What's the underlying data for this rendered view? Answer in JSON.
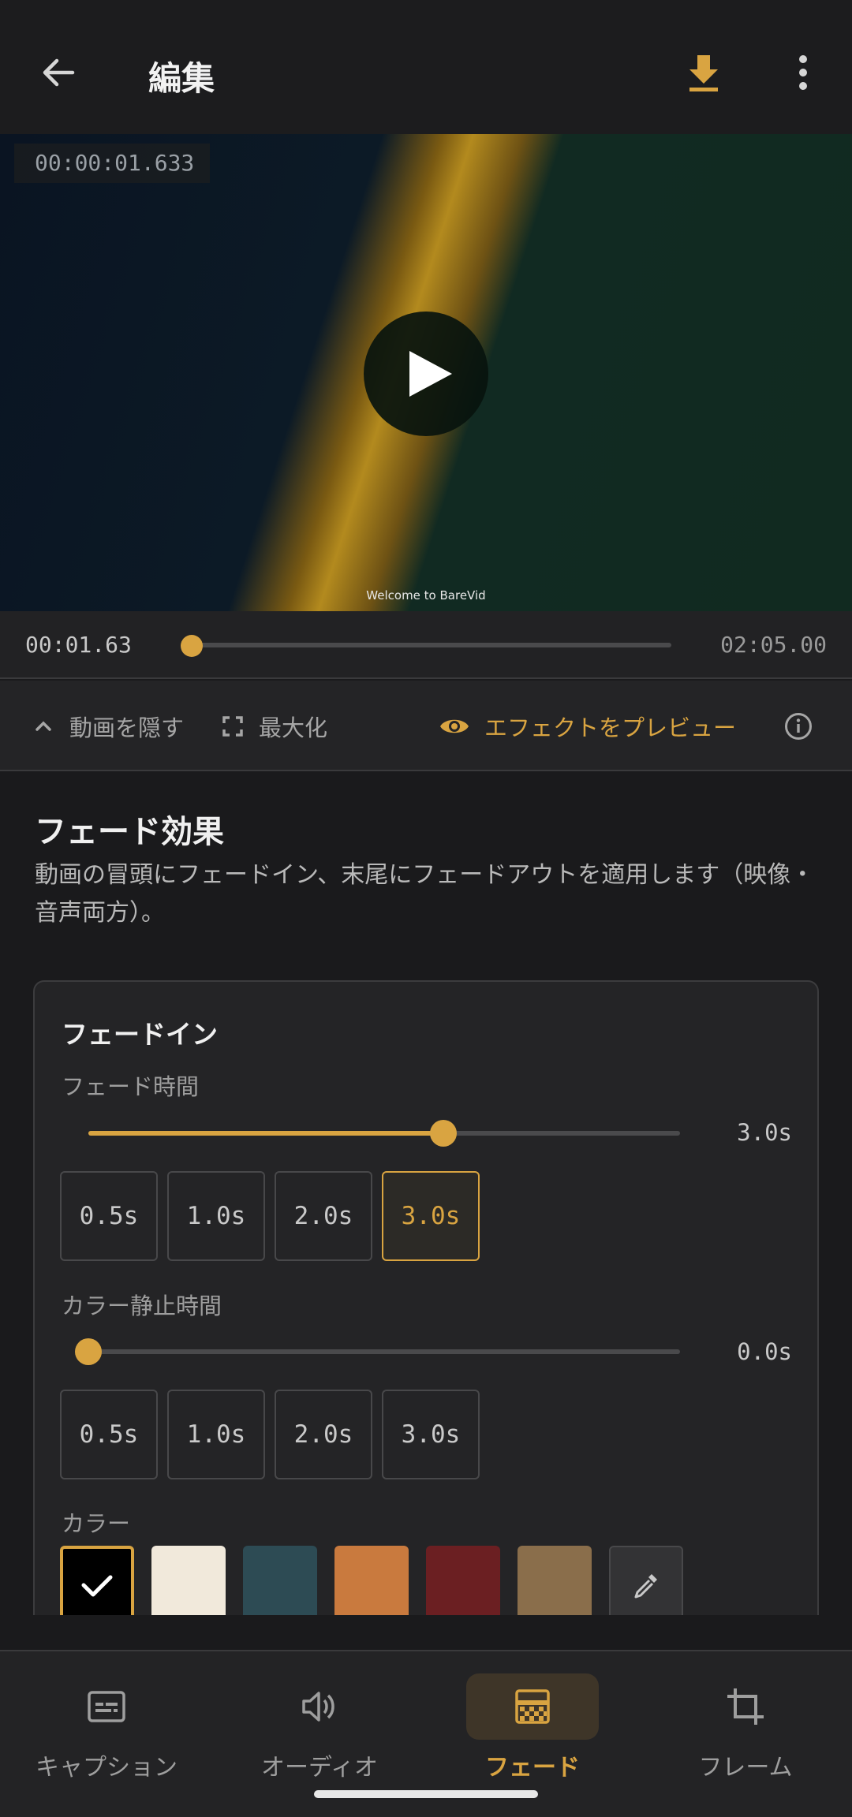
{
  "app_bar": {
    "title": "編集"
  },
  "video": {
    "timecode": "00:00:01.633",
    "caption": "Welcome to BareVid"
  },
  "seek": {
    "current": "00:01.63",
    "total": "02:05.00",
    "progress": 0.013
  },
  "toolbar": {
    "hide_video": "動画を隠す",
    "maximize": "最大化",
    "preview_effect": "エフェクトをプレビュー"
  },
  "section": {
    "title": "フェード効果",
    "description": "動画の冒頭にフェードイン、末尾にフェードアウトを適用します（映像・音声両方）。"
  },
  "fade_in": {
    "title": "フェードイン",
    "duration": {
      "label": "フェード時間",
      "value": "3.0s",
      "fraction": 0.6,
      "presets": [
        "0.5s",
        "1.0s",
        "2.0s",
        "3.0s"
      ],
      "selected_index": 3
    },
    "hold": {
      "label": "カラー静止時間",
      "value": "0.0s",
      "fraction": 0.0,
      "presets": [
        "0.5s",
        "1.0s",
        "2.0s",
        "3.0s"
      ]
    },
    "color": {
      "label": "カラー",
      "swatches": [
        "#000000",
        "#f1e9db",
        "#2d4b54",
        "#c97a3e",
        "#6b1f22",
        "#8a6e4b"
      ],
      "selected_index": 0
    }
  },
  "bottom_nav": {
    "items": [
      {
        "label": "キャプション",
        "icon": "caption-icon"
      },
      {
        "label": "オーディオ",
        "icon": "volume-icon"
      },
      {
        "label": "フェード",
        "icon": "fade-icon",
        "active": true
      },
      {
        "label": "フレーム",
        "icon": "crop-icon"
      }
    ]
  },
  "colors": {
    "accent": "#d9a441",
    "background": "#1a1a1c"
  }
}
